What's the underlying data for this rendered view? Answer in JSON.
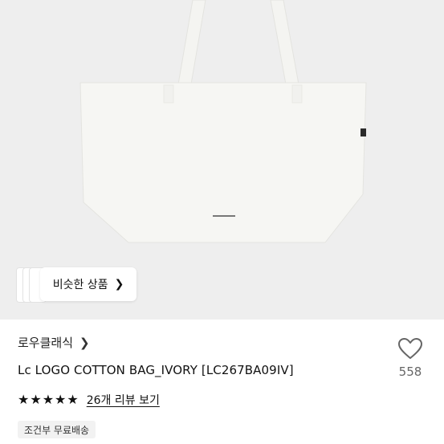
{
  "similar_products": {
    "label": "비슷한 상품",
    "chevron_icon": "chevron-right-icon"
  },
  "product": {
    "brand": "로우클래식",
    "brand_chevron_icon": "chevron-right-icon",
    "title": "Lc LOGO COTTON BAG_IVORY [LC267BA09IV]",
    "like_icon": "heart-outline-icon",
    "like_count": "558",
    "rating_stars": 5,
    "star_icon": "star-filled-icon",
    "review_label": "26개 리뷰 보기",
    "shipping_badge": "조건부 무료배송"
  },
  "colors": {
    "hero_background": "#eeeeee",
    "bag": "#f6f6f3",
    "text": "#111111",
    "like_count": "#666666"
  }
}
